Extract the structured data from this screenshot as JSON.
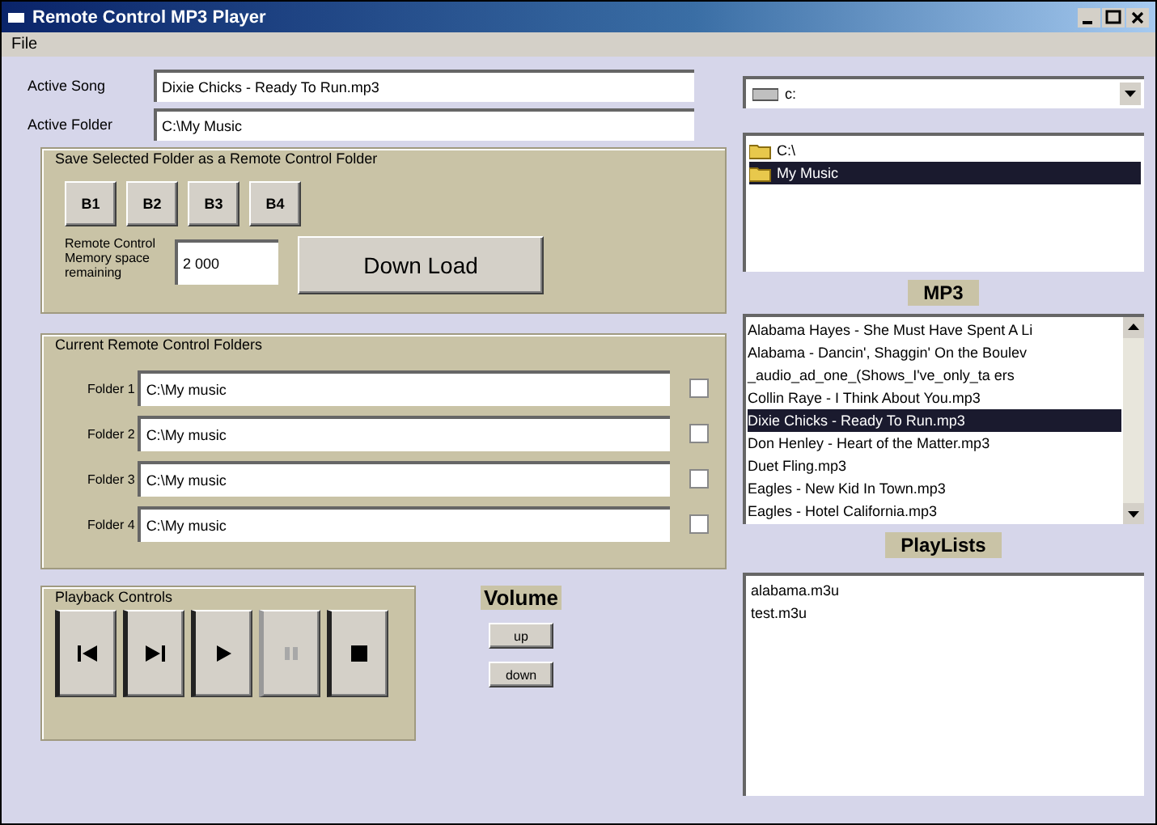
{
  "window": {
    "title": "Remote Control MP3 Player"
  },
  "menu": [
    "File"
  ],
  "active_song": {
    "label": "Active Song",
    "value": "Dixie Chicks - Ready To Run.mp3"
  },
  "active_folder": {
    "label": "Active Folder",
    "value": "C:\\My Music"
  },
  "save_group": {
    "title": "Save Selected Folder as a Remote Control Folder",
    "buttons": [
      "B1",
      "B2",
      "B3",
      "B4"
    ],
    "memory_label": "Remote Control Memory space remaining",
    "memory_value": "2 000",
    "download": "Down Load"
  },
  "folders_group": {
    "title": "Current Remote Control Folders",
    "folders": [
      {
        "label": "Folder 1",
        "value": "C:\\My music",
        "checked": false
      },
      {
        "label": "Folder 2",
        "value": "C:\\My music",
        "checked": false
      },
      {
        "label": "Folder 3",
        "value": "C:\\My music",
        "checked": false
      },
      {
        "label": "Folder 4",
        "value": "C:\\My music",
        "checked": false
      }
    ]
  },
  "playback": {
    "title": "Playback Controls",
    "buttons": [
      {
        "kind": "previous",
        "disabled": false
      },
      {
        "kind": "next",
        "disabled": false
      },
      {
        "kind": "play",
        "disabled": false
      },
      {
        "kind": "pause",
        "disabled": true
      },
      {
        "kind": "stop",
        "disabled": false
      }
    ]
  },
  "volume": {
    "label": "Volume",
    "buttons": [
      "up",
      "down"
    ]
  },
  "drive": {
    "value": "c:"
  },
  "directories": [
    {
      "name": "C:\\",
      "selected": false
    },
    {
      "name": "My Music",
      "selected": true
    }
  ],
  "mp3": {
    "label": "MP3",
    "files": [
      {
        "name": "Alabama Hayes - She Must Have Spent A Li",
        "selected": false
      },
      {
        "name": "Alabama - Dancin', Shaggin' On the Boulev",
        "selected": false
      },
      {
        "name": "_audio_ad_one_(Shows_I've_only_ta ers",
        "selected": false
      },
      {
        "name": "Collin Raye - I Think About You.mp3",
        "selected": false
      },
      {
        "name": "Dixie Chicks - Ready To Run.mp3",
        "selected": true
      },
      {
        "name": "Don Henley - Heart of the Matter.mp3",
        "selected": false
      },
      {
        "name": "Duet Fling.mp3",
        "selected": false
      },
      {
        "name": "Eagles - New Kid In Town.mp3",
        "selected": false
      },
      {
        "name": "Eagles - Hotel California.mp3",
        "selected": false
      }
    ]
  },
  "playlists": {
    "label": "PlayLists",
    "items": [
      "alabama.m3u",
      "test.m3u"
    ]
  }
}
